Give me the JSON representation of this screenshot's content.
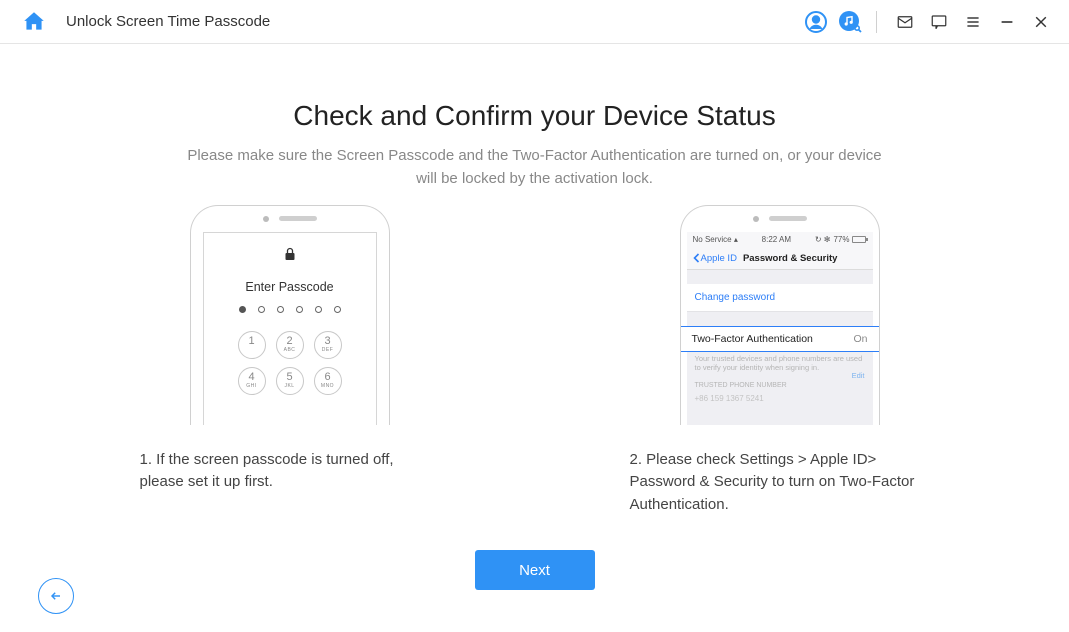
{
  "header": {
    "title": "Unlock Screen Time Passcode"
  },
  "main": {
    "title": "Check and Confirm your Device Status",
    "subtitle": "Please make sure the Screen Passcode and the Two-Factor Authentication are turned on, or your device will be locked by the activation lock."
  },
  "phone1": {
    "enter_label": "Enter Passcode",
    "keys": {
      "k1": "1",
      "k2": "2",
      "k2s": "ABC",
      "k3": "3",
      "k3s": "DEF",
      "k4": "4",
      "k4s": "GHI",
      "k5": "5",
      "k5s": "JKL",
      "k6": "6",
      "k6s": "MNO"
    }
  },
  "phone2": {
    "status_left": "No Service",
    "status_time": "8:22 AM",
    "status_pct": "77%",
    "back_label": "Apple ID",
    "nav_title": "Password & Security",
    "change_pw": "Change password",
    "tfa_label": "Two-Factor Authentication",
    "tfa_state": "On",
    "note": "Your trusted devices and phone numbers are used to verify your identity when signing in.",
    "edit": "Edit",
    "trusted": "TRUSTED PHONE NUMBER",
    "phone_num": "+86 159 1367 5241"
  },
  "captions": {
    "c1": "1. If the screen passcode is turned off, please set it up first.",
    "c2": "2. Please check Settings > Apple ID> Password & Security to turn on Two-Factor Authentication."
  },
  "footer": {
    "next": "Next"
  }
}
